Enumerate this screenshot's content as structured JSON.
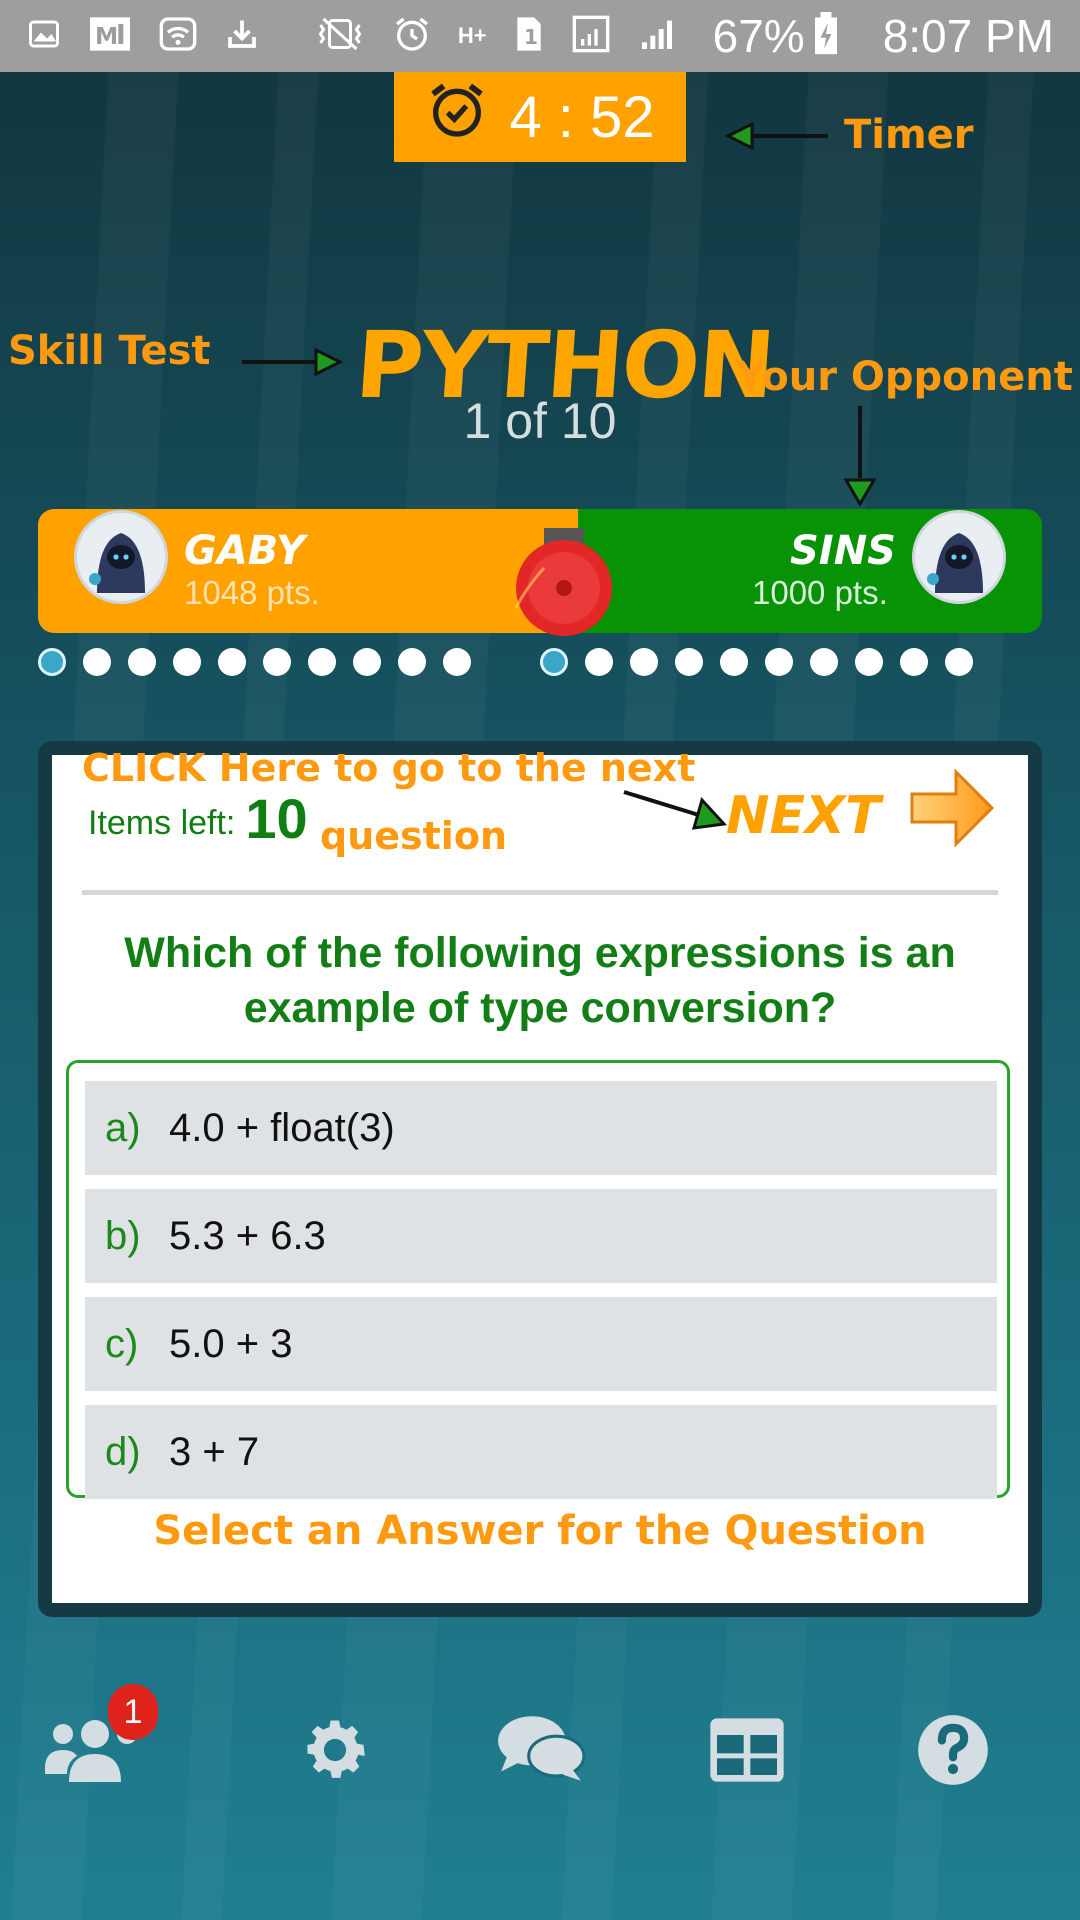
{
  "status_bar": {
    "battery": "67%",
    "time": "8:07 PM",
    "icons": [
      "image-icon",
      "ml-icon",
      "wifi-icon",
      "download-icon",
      "vibrate-off-icon",
      "alarm-icon",
      "hplus-icon",
      "sim-icon",
      "signal-icon",
      "signal-icon",
      "battery-charging-icon"
    ]
  },
  "timer": {
    "minutes": "4",
    "separator": ":",
    "seconds": "52",
    "display": "4 : 52",
    "icon": "alarm-clock-icon"
  },
  "annotations": {
    "timer": "Timer",
    "skill_test": "Skill Test",
    "opponent": "Your Opponent",
    "next_line1": "CLICK Here to go to the next",
    "next_line2": "question",
    "select": "Select an Answer for the Question"
  },
  "quiz": {
    "skill": "PYTHON",
    "progress": "1 of 10"
  },
  "players": {
    "player": {
      "name": "GABY",
      "points": "1048 pts."
    },
    "opponent": {
      "name": "SINS",
      "points": "1000 pts."
    }
  },
  "dots": {
    "player_total": 10,
    "player_active": 1,
    "opponent_total": 10,
    "opponent_active": 1
  },
  "card": {
    "items_left_label": "Items left:",
    "items_left_value": "10",
    "next_label": "NEXT",
    "question": "Which of the following expressions is an example of type conversion?",
    "answers": [
      {
        "letter": "a)",
        "text": "4.0 + float(3)"
      },
      {
        "letter": "b)",
        "text": "5.3 + 6.3"
      },
      {
        "letter": "c)",
        "text": "5.0 + 3"
      },
      {
        "letter": "d)",
        "text": "3 + 7"
      }
    ]
  },
  "bottom_nav": {
    "friends_badge": "1",
    "items": [
      "friends-icon",
      "settings-icon",
      "chat-icon",
      "leaderboard-icon",
      "help-icon"
    ]
  },
  "colors": {
    "accent": "#ffa200",
    "green": "#089206",
    "text_green": "#127e15",
    "annotation": "#ff9a10"
  }
}
